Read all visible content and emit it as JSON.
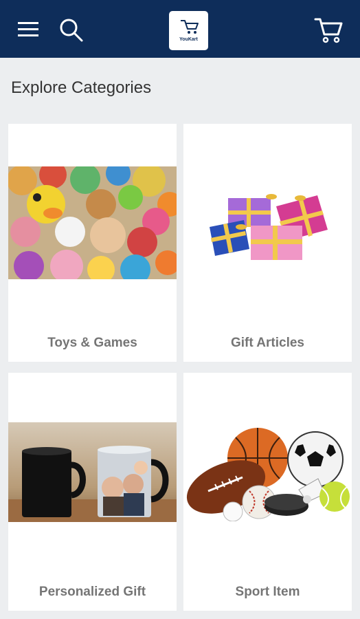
{
  "header": {
    "logo_text": "YouKart",
    "icons": [
      "menu-icon",
      "search-icon",
      "cart-icon"
    ],
    "background": "#0e2d5a"
  },
  "main": {
    "section_title": "Explore Categories",
    "categories": [
      {
        "label": "Toys & Games"
      },
      {
        "label": "Gift Articles"
      },
      {
        "label": "Personalized Gift"
      },
      {
        "label": "Sport Item"
      }
    ]
  }
}
